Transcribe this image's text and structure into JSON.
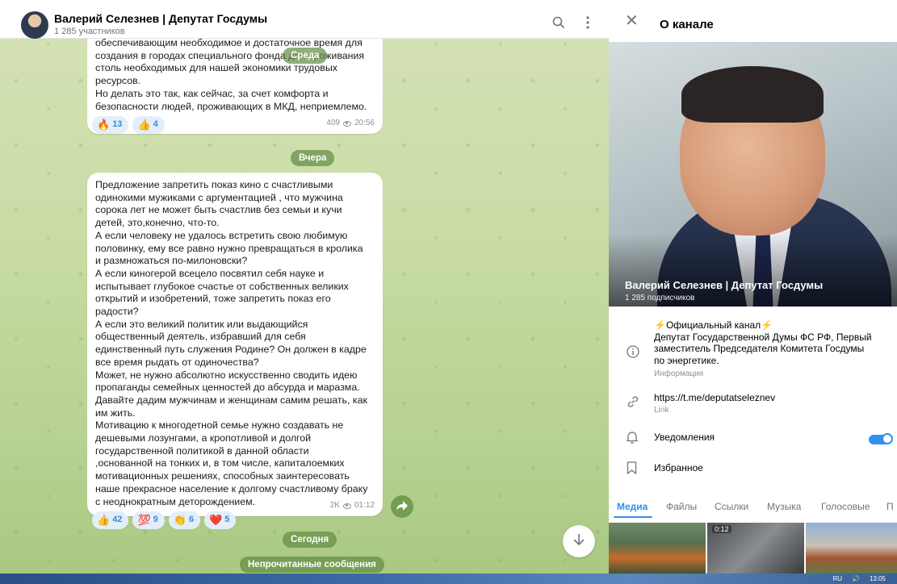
{
  "chat": {
    "title": "Валерий Селезнев | Депутат Госдумы",
    "members": "1 285 участников",
    "search_icon": "search-icon",
    "menu_icon": "more-vertical-icon"
  },
  "messages": [
    {
      "text": "обеспечивающим необходимое и достаточное время для\nсоздания в городах специального фонда для проживания\nстоль необходимых для нашей экономики трудовых\nресурсов.\nНо делать это так, как сейчас, за счет комфорта и\nбезопасности людей, проживающих в МКД, неприемлемо.",
      "reactions": [
        {
          "emoji": "🔥",
          "count": "13"
        },
        {
          "emoji": "👍",
          "count": "4"
        }
      ],
      "views": "409",
      "time": "20:56"
    },
    {
      "text": "Предложение запретить показ кино с счастливыми\nодинокими мужиками с аргументацией , что мужчина\nсорока лет не может быть счастлив без семьи и кучи\nдетей, это,конечно, что-то.\nА если человеку не удалось встретить свою любимую\nполовинку, ему все равно нужно превращаться в кролика\nи размножаться по-милоновски?\nА если киногерой всецело посвятил себя науке и\nиспытывает глубокое счастье от собственных великих\nоткрытий и изобретений, тоже запретить показ его\nрадости?\nА если это великий политик или выдающийся\nобщественный деятель, избравший для себя\nединственный путь служения Родине? Он должен в кадре\nвсе время рыдать от одиночества?\nМожет, не нужно абсолютно искусственно сводить идею\nпропаганды семейных ценностей до абсурда и маразма.\nДавайте дадим мужчинам и женщинам самим решать, как\nим жить.\nМотивацию к многодетной семье нужно создавать не\nдешевыми лозунгами, а кропотливой и долгой\nгосударственной политикой в данной области\n,основанной на тонких и, в том числе, капиталоемких\nмотивационных решениях, способных заинтересовать\nнаше прекрасное население к долгому счастливому браку\nс неоднократным деторождением.",
      "reactions": [
        {
          "emoji": "👍",
          "count": "42"
        },
        {
          "emoji": "💯",
          "count": "9"
        },
        {
          "emoji": "👏",
          "count": "6"
        },
        {
          "emoji": "❤️",
          "count": "5"
        }
      ],
      "views": "2K",
      "time": "01:12"
    }
  ],
  "dates": {
    "wednesday": "Среда",
    "yesterday": "Вчера",
    "today": "Сегодня",
    "unread": "Непрочитанные сообщения"
  },
  "info": {
    "header_title": "О канале",
    "channel_name": "Валерий Селезнев | Депутат Госдумы",
    "subscribers": "1 285 подписчиков",
    "description": "⚡Официальный канал⚡\nДепутат Государственной Думы ФС РФ, Первый\nзаместитель Председателя Комитета Госдумы\nпо энергетике.",
    "description_label": "Информация",
    "link": "https://t.me/deputatseleznev",
    "link_label": "Link",
    "notifications": "Уведомления",
    "notifications_on": true,
    "favorites": "Избранное",
    "media_tabs": [
      "Медиа",
      "Файлы",
      "Ссылки",
      "Музыка",
      "Голосовые",
      "П"
    ],
    "thumb_duration": "0:12"
  },
  "taskbar": {
    "lang": "RU",
    "time": "13:05"
  },
  "colors": {
    "accent": "#3390ec",
    "chat_green": "#b8d293"
  }
}
